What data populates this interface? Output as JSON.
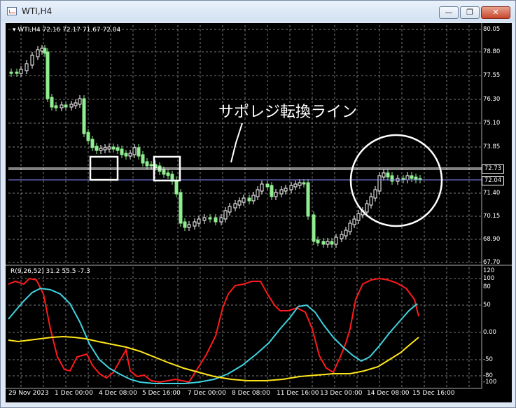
{
  "window": {
    "title": "WTI,H4",
    "minimize_glyph": "—",
    "maximize_glyph": "❐",
    "close_glyph": "✕"
  },
  "chart": {
    "ohlc_text": "▾ WTI,H4  72.16 72.17 71.67 72.04",
    "annotation": "サポレジ転換ライン",
    "price_axis": [
      "80.05",
      "78.80",
      "77.55",
      "76.30",
      "75.10",
      "73.85",
      "72.73",
      "72.04",
      "71.40",
      "70.15",
      "68.90",
      "67.70"
    ],
    "line_price": "72.73",
    "current_price": "72.04",
    "time_axis": [
      "29 Nov 2023",
      "1 Dec 00:00",
      "4 Dec 08:00",
      "5 Dec 16:00",
      "7 Dec 00:00",
      "8 Dec 08:00",
      "11 Dec 16:00",
      "13 Dec 00:00",
      "14 Dec 08:00",
      "15 Dec 16:00"
    ],
    "colors": {
      "bull": "#ffffff",
      "bear": "#90ee90",
      "line": "#ffffff",
      "bid": "#8c8cff"
    }
  },
  "oscillator": {
    "label": "R(9,26,52) 31.2 55.5 -7.3",
    "axis": [
      "120",
      "100",
      "80",
      "50",
      "0.00",
      "-50",
      "-80",
      "-100"
    ],
    "colors": {
      "red": "#ff1a1a",
      "cyan": "#3fd3e0",
      "yellow": "#ffe61a"
    }
  }
}
